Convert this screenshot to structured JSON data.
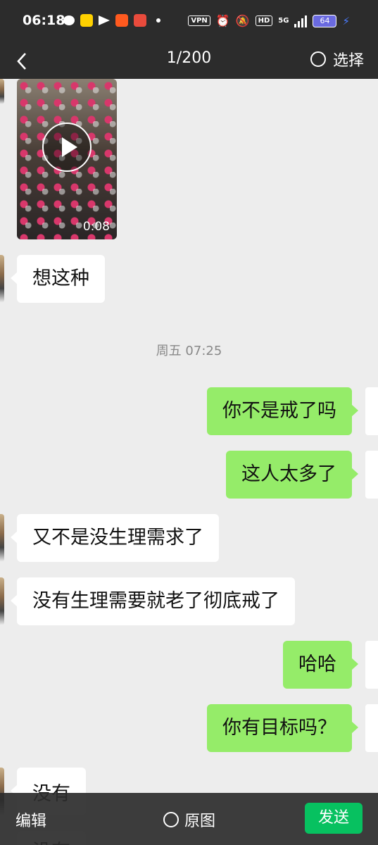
{
  "status_bar": {
    "time": "06:18",
    "vpn": "VPN",
    "hd": "HD",
    "network": "5G",
    "battery": "64",
    "left_icons": [
      "wechat-icon",
      "meituan-icon",
      "telegram-icon",
      "app-icon",
      "game-icon"
    ],
    "right_icons": [
      "alarm-icon",
      "mute-icon",
      "signal-icon",
      "charging-icon"
    ]
  },
  "header": {
    "title": "1/200",
    "select_label": "选择"
  },
  "chat": {
    "video": {
      "duration": "0:08"
    },
    "messages": [
      {
        "side": "in",
        "text": "想这种"
      },
      {
        "side": "time",
        "text": "周五 07:25"
      },
      {
        "side": "out",
        "text": "你不是戒了吗"
      },
      {
        "side": "out",
        "text": "这人太多了"
      },
      {
        "side": "in",
        "text": "又不是没生理需求了"
      },
      {
        "side": "in",
        "text": "没有生理需要就老了彻底戒了"
      },
      {
        "side": "out",
        "text": "哈哈"
      },
      {
        "side": "out",
        "text": "你有目标吗？"
      },
      {
        "side": "in",
        "text": "没有"
      },
      {
        "side": "in",
        "text": "没有"
      }
    ]
  },
  "bottom_bar": {
    "edit_label": "编辑",
    "original_label": "原图",
    "send_label": "发送"
  },
  "colors": {
    "header_bg": "#2c2c2c",
    "chat_bg": "#ededed",
    "outgoing_bubble": "#95ec69",
    "incoming_bubble": "#ffffff",
    "send_button": "#07c160"
  }
}
